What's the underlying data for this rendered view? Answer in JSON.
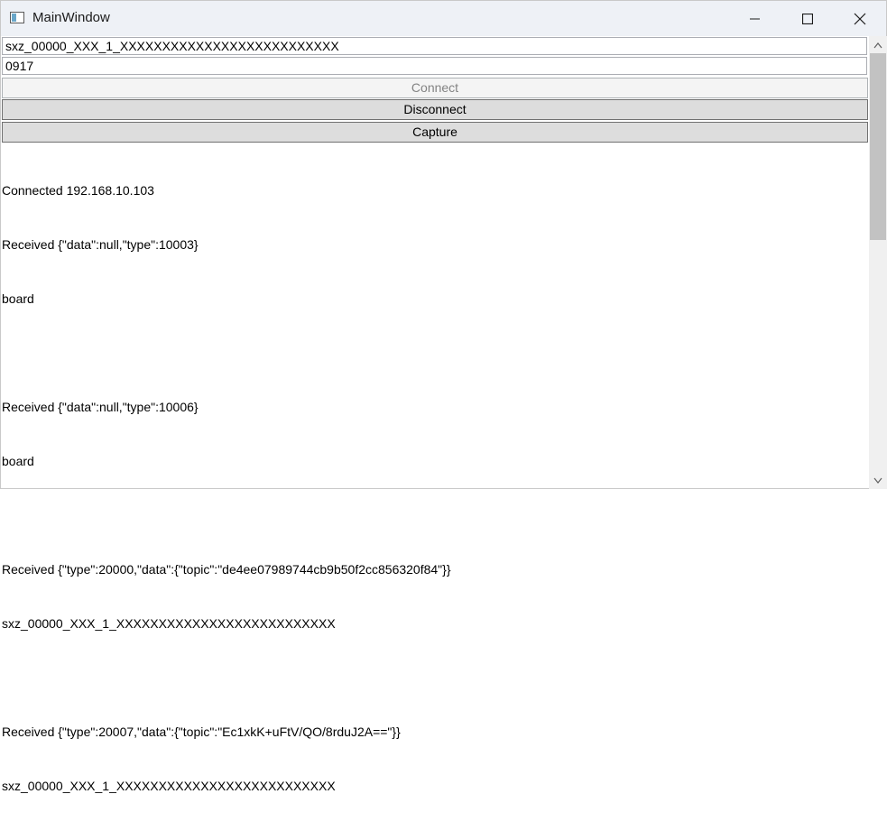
{
  "window": {
    "title": "MainWindow",
    "icons": {
      "app": "app-window-icon",
      "minimize": "minimize-icon",
      "maximize": "maximize-icon",
      "close": "close-icon"
    }
  },
  "form": {
    "topic_value": "sxz_00000_XXX_1_XXXXXXXXXXXXXXXXXXXXXXXXXX",
    "code_value": "0917",
    "connect_label": "Connect",
    "connect_disabled": true,
    "disconnect_label": "Disconnect",
    "capture_label": "Capture"
  },
  "log": {
    "lines": [
      "Connected 192.168.10.103",
      "Received {\"data\":null,\"type\":10003}",
      "board",
      "",
      "Received {\"data\":null,\"type\":10006}",
      "board",
      "",
      "Received {\"type\":20000,\"data\":{\"topic\":\"de4ee07989744cb9b50f2cc856320f84\"}}",
      "sxz_00000_XXX_1_XXXXXXXXXXXXXXXXXXXXXXXXXX",
      "",
      "Received {\"type\":20007,\"data\":{\"topic\":\"Ec1xkK+uFtV/QO/8rduJ2A==\"}}",
      "sxz_00000_XXX_1_XXXXXXXXXXXXXXXXXXXXXXXXXX"
    ]
  },
  "scrollbar": {
    "icons": {
      "up": "chevron-up-icon",
      "down": "chevron-down-icon"
    }
  }
}
